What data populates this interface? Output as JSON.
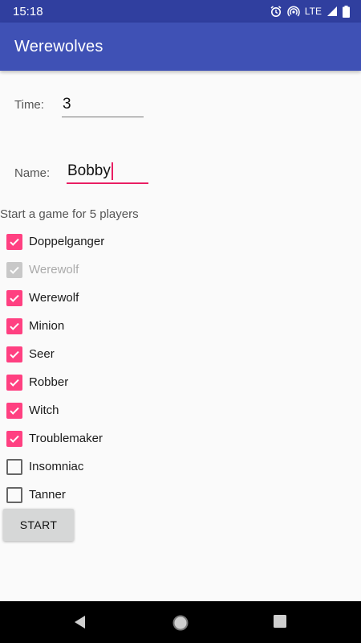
{
  "status_bar": {
    "time": "15:18",
    "network": "LTE",
    "icons": [
      "alarm-icon",
      "hotspot-icon",
      "lte-signal-icon",
      "battery-icon"
    ]
  },
  "app_bar": {
    "title": "Werewolves"
  },
  "form": {
    "time_label": "Time:",
    "time_value": "3",
    "name_label": "Name:",
    "name_value": "Bobby"
  },
  "players_text": "Start a game for 5 players",
  "roles": [
    {
      "label": "Doppelganger",
      "checked": true,
      "enabled": true
    },
    {
      "label": "Werewolf",
      "checked": true,
      "enabled": false
    },
    {
      "label": "Werewolf",
      "checked": true,
      "enabled": true
    },
    {
      "label": "Minion",
      "checked": true,
      "enabled": true
    },
    {
      "label": "Seer",
      "checked": true,
      "enabled": true
    },
    {
      "label": "Robber",
      "checked": true,
      "enabled": true
    },
    {
      "label": "Witch",
      "checked": true,
      "enabled": true
    },
    {
      "label": "Troublemaker",
      "checked": true,
      "enabled": true
    },
    {
      "label": "Insomniac",
      "checked": false,
      "enabled": true
    },
    {
      "label": "Tanner",
      "checked": false,
      "enabled": true
    }
  ],
  "start_label": "START",
  "colors": {
    "app_bar": "#3f51b5",
    "status_bar": "#303f9f",
    "accent": "#ff4081"
  },
  "nav_bar": {
    "buttons": [
      "back-icon",
      "home-icon",
      "recents-icon"
    ]
  }
}
